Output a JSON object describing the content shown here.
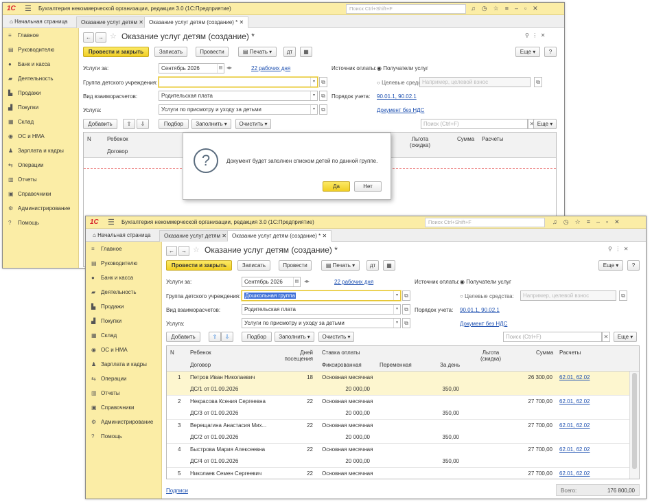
{
  "app_title": "Бухгалтерия некоммерческой организации, редакция 3.0  (1С:Предприятие)",
  "search_placeholder": "Поиск Ctrl+Shift+F",
  "tabs": [
    "Начальная страница",
    "Оказание услуг детям",
    "Оказание услуг детям (создание) *"
  ],
  "sidebar": [
    "Главное",
    "Руководителю",
    "Банк и касса",
    "Деятельность",
    "Продажи",
    "Покупки",
    "Склад",
    "ОС и НМА",
    "Зарплата и кадры",
    "Операции",
    "Отчеты",
    "Справочники",
    "Администрирование",
    "Помощь"
  ],
  "doc_title": "Оказание услуг детям (создание) *",
  "toolbar": {
    "post_close": "Провести и закрыть",
    "save": "Записать",
    "post": "Провести",
    "print": "Печать",
    "more": "Еще",
    "help": "?"
  },
  "form": {
    "period_label": "Услуги за:",
    "period_value": "Сентябрь 2026",
    "workdays": "22 рабочих дня",
    "group_label": "Группа детского учреждения:",
    "group_value_empty": "",
    "group_value": "Дошкольная группа",
    "settlement_label": "Вид взаиморасчетов:",
    "settlement_value": "Родительская плата",
    "service_label": "Услуга:",
    "service_value": "Услуги по присмотру и уходу за детьми",
    "source_label": "Источник оплаты:",
    "source_opt1": "Получатели услуг",
    "source_opt2": "Целевые средства:",
    "source_placeholder": "Например, целевой взнос",
    "accounting_label": "Порядок учета:",
    "accounting_value": "90.01.1, 90.02.1",
    "vat_link": "Документ без НДС"
  },
  "table_toolbar": {
    "add": "Добавить",
    "selection": "Подбор",
    "fill": "Заполнить",
    "clear": "Очистить",
    "search_placeholder": "Поиск (Ctrl+F)",
    "more": "Еще"
  },
  "table_headers": {
    "n": "N",
    "child": "Ребенок",
    "contract": "Договор",
    "days": "Дней посещения",
    "rate": "Ставка оплаты",
    "fixed": "Фиксированная",
    "variable": "Переменная",
    "per_day": "За день",
    "benefit": "Льгота (скидка)",
    "sum": "Сумма",
    "settlements": "Расчеты"
  },
  "rows": [
    {
      "n": "1",
      "child": "Петров Иван Николаевич",
      "contract": "ДС/1 от 01.09.2026",
      "days": "18",
      "rate": "Основная месячная",
      "fixed": "20 000,00",
      "per_day": "350,00",
      "sum": "26 300,00",
      "acc": "62.01, 62.02"
    },
    {
      "n": "2",
      "child": "Некрасова Ксения Сергеевна",
      "contract": "ДС/3 от 01.09.2026",
      "days": "22",
      "rate": "Основная месячная",
      "fixed": "20 000,00",
      "per_day": "350,00",
      "sum": "27 700,00",
      "acc": "62.01, 62.02"
    },
    {
      "n": "3",
      "child": "Верещагина Анастасия Мих...",
      "contract": "ДС/2 от 01.09.2026",
      "days": "22",
      "rate": "Основная месячная",
      "fixed": "20 000,00",
      "per_day": "350,00",
      "sum": "27 700,00",
      "acc": "62.01, 62.02"
    },
    {
      "n": "4",
      "child": "Быстрова Мария Алексеевна",
      "contract": "ДС/4 от 01.09.2026",
      "days": "22",
      "rate": "Основная месячная",
      "fixed": "20 000,00",
      "per_day": "350,00",
      "sum": "27 700,00",
      "acc": "62.01, 62.02"
    },
    {
      "n": "5",
      "child": "Николаев Семен Сергеевич",
      "contract": "",
      "days": "22",
      "rate": "Основная месячная",
      "fixed": "",
      "per_day": "",
      "sum": "27 700,00",
      "acc": "62.01, 62.02"
    }
  ],
  "footer": {
    "signatures": "Подписи",
    "total_label": "Всего:",
    "total_value": "176 800,00"
  },
  "dialog": {
    "message": "Документ будет заполнен списком детей по данной группе.",
    "yes": "Да",
    "no": "Нет"
  }
}
